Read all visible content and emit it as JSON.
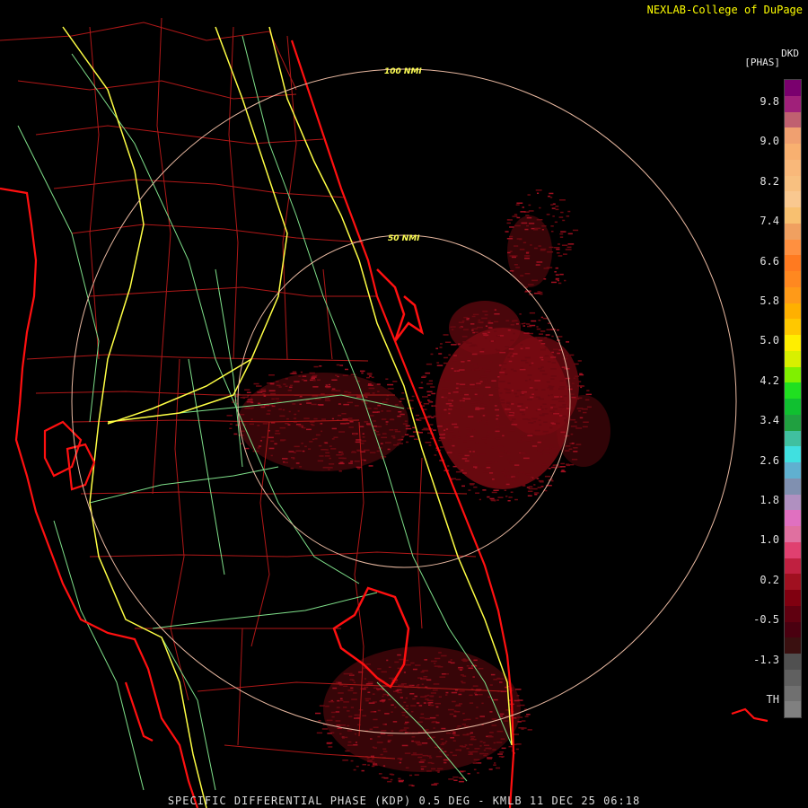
{
  "header": {
    "credit": "NEXLAB-College of DuPage"
  },
  "footer": {
    "caption": "SPECIFIC DIFFERENTIAL PHASE (KDP) 0.5 DEG - KMLB 11 DEC 25 06:18"
  },
  "map": {
    "range_rings": [
      {
        "label": "50 NMI"
      },
      {
        "label": "100 NMI"
      }
    ],
    "colors": {
      "coast": "#ff1010",
      "county": "#b01818",
      "roads": "#7fe08a",
      "interstate": "#ffff44",
      "rings": "#e8b8a0",
      "echo": "#7a0a12"
    }
  },
  "legend": {
    "product_code": "DKD",
    "unit": "[PHAS]",
    "ticks": [
      "9.8",
      "9.0",
      "8.2",
      "7.4",
      "6.6",
      "5.8",
      "5.0",
      "4.2",
      "3.4",
      "2.6",
      "1.8",
      "1.0",
      "0.2",
      "-0.5",
      "-1.3",
      "TH"
    ],
    "colors": [
      "#7a006e",
      "#a0207a",
      "#c06070",
      "#f0a070",
      "#f8b070",
      "#f9b87a",
      "#f8c080",
      "#f9c890",
      "#f8c070",
      "#f0a060",
      "#ff9040",
      "#ff7a20",
      "#ff8820",
      "#ff9a18",
      "#ffb000",
      "#ffc800",
      "#ffee00",
      "#d8f000",
      "#80f000",
      "#20e020",
      "#10c030",
      "#20a040",
      "#40c0a0",
      "#40e0e0",
      "#60b0d0",
      "#8090b0",
      "#b090c0",
      "#e070c0",
      "#e070a0",
      "#e04070",
      "#c02040",
      "#a01020",
      "#800010",
      "#600010",
      "#4a0010",
      "#3a1010",
      "#505050",
      "#606060",
      "#707070",
      "#808080"
    ]
  }
}
